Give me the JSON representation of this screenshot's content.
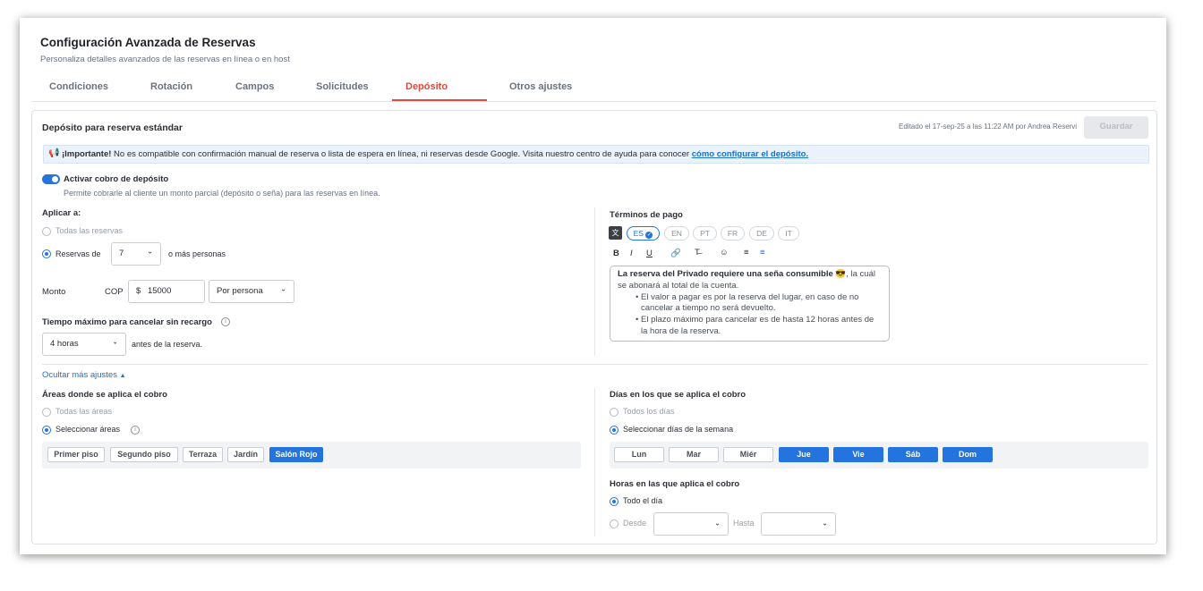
{
  "page": {
    "title": "Configuración Avanzada de Reservas",
    "subtitle": "Personaliza detalles avanzados de las reservas en línea o en host"
  },
  "tabs": [
    {
      "label": "Condiciones"
    },
    {
      "label": "Rotación"
    },
    {
      "label": "Campos"
    },
    {
      "label": "Solicitudes"
    },
    {
      "label": "Depósito"
    },
    {
      "label": "Otros ajustes"
    }
  ],
  "active_tab": "Depósito",
  "section": {
    "title": "Depósito para reserva estándar",
    "edited": "Editado el 17-sep-25 a las 11:22 AM por Andrea Reservi",
    "save_label": "Guardar"
  },
  "notice": {
    "strong": "¡Importante!",
    "text": " No es compatible con confirmación manual de reserva o lista de espera en línea, ni reservas desde Google. Visita nuestro centro de ayuda para conocer ",
    "link": "cómo configurar el depósito."
  },
  "deposit_toggle": {
    "label": "Activar cobro de depósito",
    "description": "Permite cobrarle al cliente un monto parcial (depósito o seña) para las reservas en línea."
  },
  "apply": {
    "label": "Aplicar a:",
    "option_all": "Todas las reservas",
    "option_from": "Reservas de",
    "party_size": "7",
    "suffix": "o más personas"
  },
  "amount": {
    "label": "Monto",
    "currency": "COP",
    "symbol": "$",
    "value": "15000",
    "per": "Por persona"
  },
  "cancel": {
    "label": "Tiempo máximo para cancelar sin recargo",
    "value": "4 horas",
    "suffix": "antes de la reserva."
  },
  "terms": {
    "label": "Términos de pago",
    "languages": [
      "ES",
      "EN",
      "PT",
      "FR",
      "DE",
      "IT"
    ],
    "selected_language": "ES",
    "toolbar": [
      "B",
      "I",
      "U",
      "link-icon",
      "clear-format-icon",
      "emoji-icon",
      "ordered-list-icon",
      "bullet-list-icon"
    ],
    "text_bold": "La reserva del Privado requiere una seña consumible",
    "emoji": "😎",
    "text_rest": ", la cuál se abonará al total de la cuenta.",
    "bullets": [
      "El valor a pagar es por la reserva del lugar, en caso de no cancelar a tiempo no será devuelto.",
      "El plazo máximo para cancelar es de hasta 12 horas antes de la hora de la reserva."
    ]
  },
  "more_settings_link": "Ocultar más ajustes",
  "areas": {
    "label": "Áreas donde se aplica el cobro",
    "option_all": "Todas las áreas",
    "option_select": "Seleccionar áreas",
    "items": [
      {
        "label": "Primer piso",
        "selected": false
      },
      {
        "label": "Segundo piso",
        "selected": false
      },
      {
        "label": "Terraza",
        "selected": false
      },
      {
        "label": "Jardín",
        "selected": false
      },
      {
        "label": "Salón Rojo",
        "selected": true
      }
    ]
  },
  "days": {
    "label": "Días en los que se aplica el cobro",
    "option_all": "Todos los días",
    "option_select": "Seleccionar días de la semana",
    "items": [
      {
        "label": "Lun",
        "selected": false
      },
      {
        "label": "Mar",
        "selected": false
      },
      {
        "label": "Miér",
        "selected": false
      },
      {
        "label": "Jue",
        "selected": true
      },
      {
        "label": "Vie",
        "selected": true
      },
      {
        "label": "Sáb",
        "selected": true
      },
      {
        "label": "Dom",
        "selected": true
      }
    ]
  },
  "hours": {
    "label": "Horas en las que aplica el cobro",
    "option_all": "Todo el día",
    "option_from": "Desde",
    "to": "Hasta"
  },
  "colors": {
    "accent": "#2474e0",
    "active_tab": "#e0493e"
  }
}
